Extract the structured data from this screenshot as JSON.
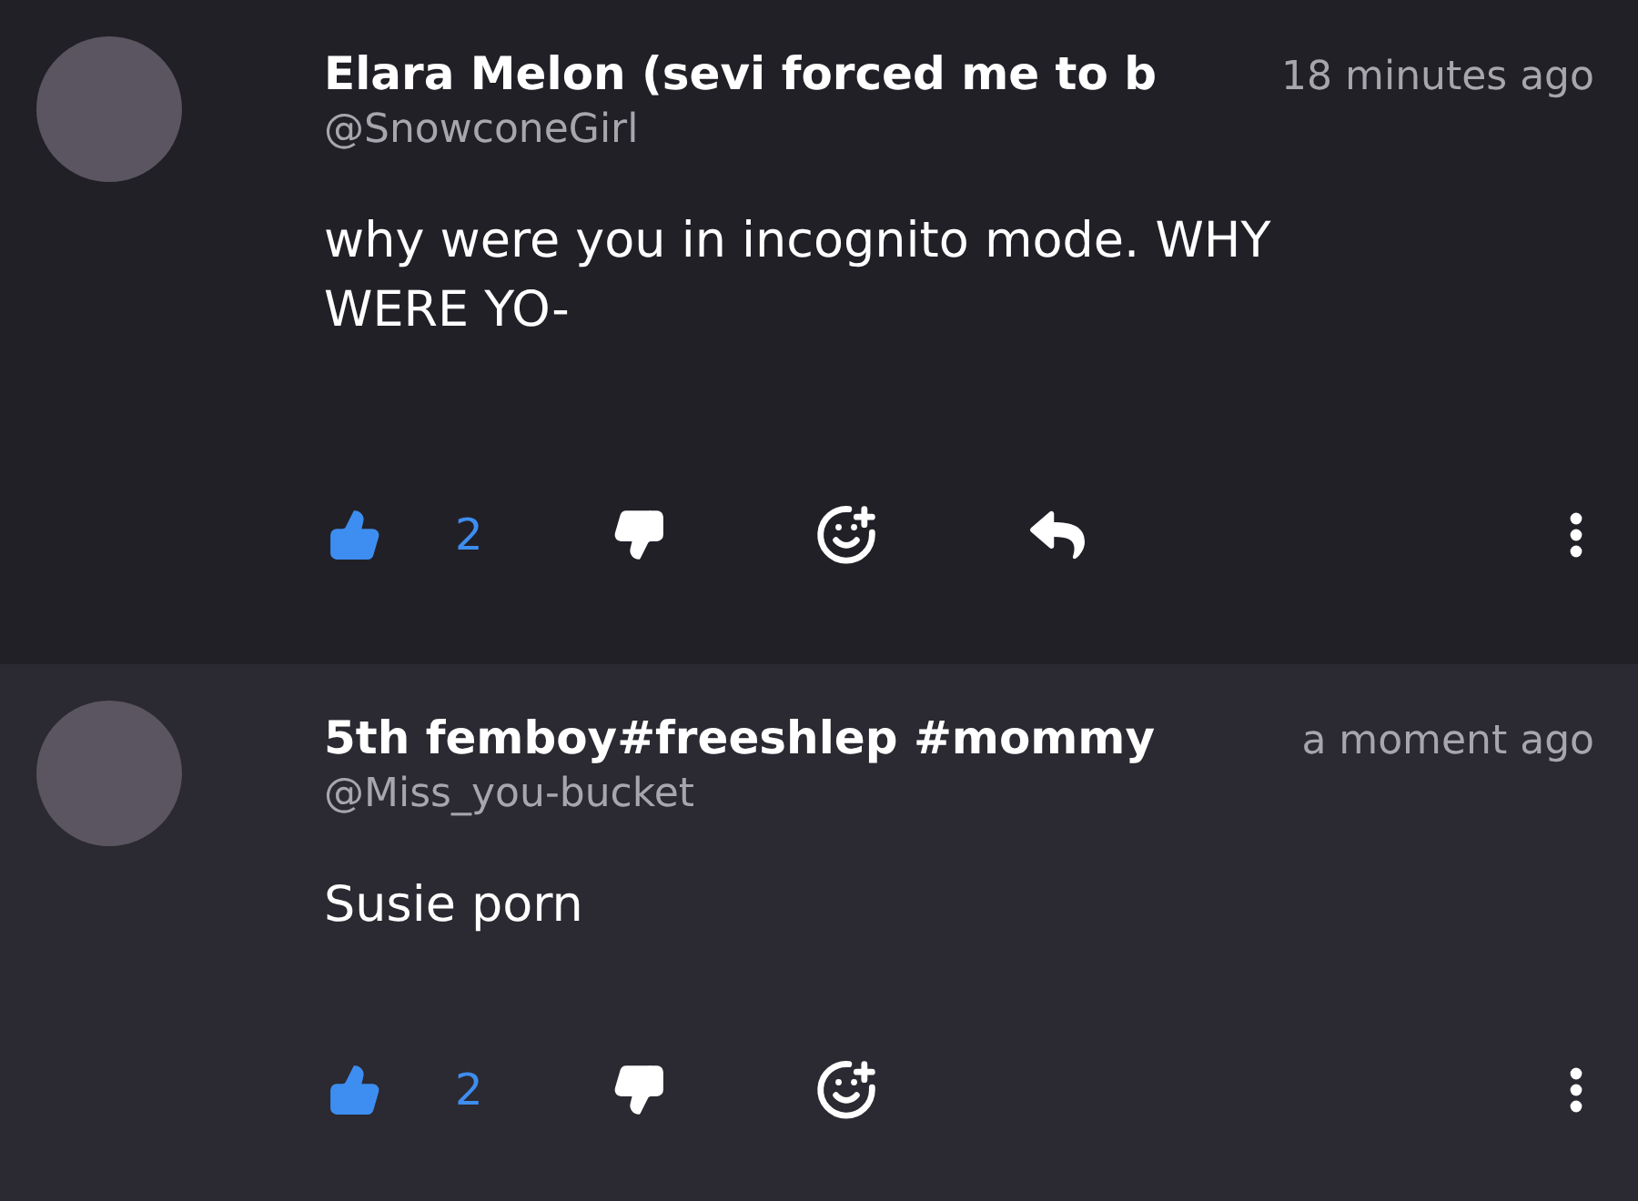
{
  "comments": [
    {
      "author": "Elara Melon (sevi forced me to b",
      "handle": "@SnowconeGirl",
      "time": "18 minutes ago",
      "text": "why were you in incognito mode. WHY WERE YO-",
      "likes": "2",
      "liked": true,
      "highlighted": false,
      "actions": [
        {
          "kind": "like"
        },
        {
          "kind": "dislike"
        },
        {
          "kind": "react"
        },
        {
          "kind": "reply"
        },
        {
          "kind": "more"
        }
      ]
    },
    {
      "author": "5th femboy#freeshlep #mommy",
      "handle": "@Miss_you-bucket",
      "time": "a moment ago",
      "text": "Susie porn",
      "likes": "2",
      "liked": true,
      "highlighted": true,
      "actions": [
        {
          "kind": "like"
        },
        {
          "kind": "dislike"
        },
        {
          "kind": "react"
        },
        {
          "kind": "more"
        }
      ]
    }
  ]
}
